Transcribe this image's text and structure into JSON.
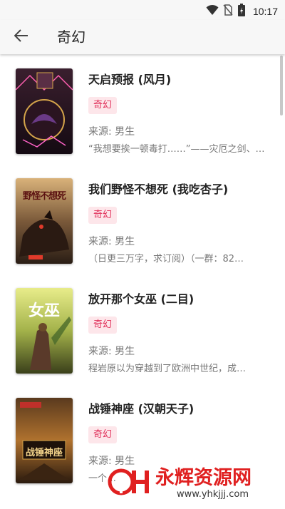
{
  "status_bar": {
    "time": "10:17",
    "icons": [
      "wifi-icon",
      "no-sim-icon",
      "battery-icon"
    ]
  },
  "app_bar": {
    "title": "奇幻",
    "back_icon": "arrow-left-icon"
  },
  "books": [
    {
      "title": "天启预报 (风月)",
      "tag": "奇幻",
      "source": "来源: 男生",
      "desc": "“我想要挨一顿毒打……”——灾厄之剑、…",
      "cover_text": ""
    },
    {
      "title": "我们野怪不想死 (我吃杏子)",
      "tag": "奇幻",
      "source": "来源: 男生",
      "desc": "（日更三万字，求订阅）（一群：82…",
      "cover_text": "野怪不想死"
    },
    {
      "title": "放开那个女巫 (二目)",
      "tag": "奇幻",
      "source": "来源: 男生",
      "desc": "程岩原以为穿越到了欧洲中世纪，成…",
      "cover_text": "女巫"
    },
    {
      "title": "战锤神座 (汉朝天子)",
      "tag": "奇幻",
      "source": "来源: 男生",
      "desc": "一个…",
      "cover_text": "战锤神座"
    }
  ],
  "watermark": {
    "brand": "永辉资源网",
    "url": "www.yhkjjj.com"
  },
  "colors": {
    "accent": "#e0305a",
    "tag_bg": "#fde6ea"
  }
}
